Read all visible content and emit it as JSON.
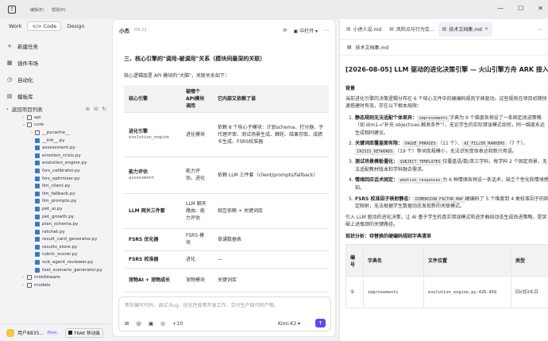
{
  "titlebar": {
    "logo": "T",
    "menu": [
      "编辑(E)",
      "帮助(H)"
    ],
    "controls": {
      "minimize": "—",
      "maximize": "☐",
      "close": "✕"
    }
  },
  "sidebar": {
    "modes": [
      {
        "label": "Work",
        "active": false
      },
      {
        "label": "Code",
        "active": true,
        "icon": "code-icon"
      },
      {
        "label": "Design",
        "active": false
      }
    ],
    "nav": [
      {
        "label": "新建任务",
        "icon": "plus-icon",
        "glyph": "+"
      },
      {
        "label": "插件市场",
        "icon": "grid-icon",
        "glyph": "▦"
      },
      {
        "label": "自动化",
        "icon": "clock-icon",
        "glyph": "◷"
      },
      {
        "label": "模板库",
        "icon": "template-icon",
        "glyph": "▤"
      }
    ],
    "project_header": "返回项目列表",
    "tree": [
      {
        "label": "api",
        "type": "folder",
        "depth": 2,
        "open": false
      },
      {
        "label": "core",
        "type": "folder",
        "depth": 2,
        "open": true
      },
      {
        "label": "__pycache__",
        "type": "folder",
        "depth": 3,
        "open": false
      },
      {
        "label": "__init__.py",
        "type": "py",
        "depth": 3
      },
      {
        "label": "assessment.py",
        "type": "py",
        "depth": 3
      },
      {
        "label": "emotion_crisis.py",
        "type": "py",
        "depth": 3
      },
      {
        "label": "evolution_engine.py",
        "type": "py",
        "depth": 3
      },
      {
        "label": "fsrs_calibrator.py",
        "type": "py",
        "depth": 3
      },
      {
        "label": "fsrs_optimizer.py",
        "type": "py",
        "depth": 3
      },
      {
        "label": "llm_client.py",
        "type": "py",
        "depth": 3
      },
      {
        "label": "llm_fallback.py",
        "type": "py",
        "depth": 3
      },
      {
        "label": "llm_prompts.py",
        "type": "py",
        "depth": 3
      },
      {
        "label": "pet_ai.py",
        "type": "py",
        "depth": 3
      },
      {
        "label": "pet_growth.py",
        "type": "py",
        "depth": 3
      },
      {
        "label": "plan_schema.py",
        "type": "py",
        "depth": 3
      },
      {
        "label": "ratchet.py",
        "type": "py",
        "depth": 3
      },
      {
        "label": "result_card_generator.py",
        "type": "py",
        "depth": 3
      },
      {
        "label": "results_store.py",
        "type": "py",
        "depth": 3
      },
      {
        "label": "rubric_scorer.py",
        "type": "py",
        "depth": 3
      },
      {
        "label": "sub_agent_reviewer.py",
        "type": "py",
        "depth": 3
      },
      {
        "label": "test_scenario_generator.py",
        "type": "py",
        "depth": 3
      },
      {
        "label": "middleware",
        "type": "folder",
        "depth": 2,
        "open": false
      },
      {
        "label": "models",
        "type": "folder",
        "depth": 2,
        "open": false
      }
    ],
    "user": {
      "name": "用户8835...",
      "badge": "Pro+",
      "trae_label": "TRAE 移动端"
    }
  },
  "chat": {
    "title": "小杰",
    "time": "09:21",
    "open_in": "中打开",
    "section_title": "三、核心引擎的\"调用-被调用\"关系（模块间最深的关联）",
    "intro": "核心逻辑层是 API 模块的\"大脑\"，关联关系如下：",
    "table_headers": [
      "核心引擎",
      "被哪个 API模块 调用",
      "它内部又依赖了谁"
    ],
    "rows": [
      {
        "name": "进化引擎",
        "code": "evolution_engine",
        "caller": "进化模块",
        "deps": "依赖 8 个核心子模块：计划schema、打分器、子代理评审、测试场景生成、棘轮、结果存取、成绩卡生成、FSRS校准器"
      },
      {
        "name": "能力评估",
        "code": "assessment",
        "caller": "能力评估、进化",
        "deps": "依赖 LLM 三件套（client/prompts/fallback）"
      },
      {
        "name": "LLM 网关三件套",
        "code": "",
        "caller": "LLM 聊天路由、能力评估",
        "deps": "相互依赖 + 关键词库"
      },
      {
        "name": "FSRS 优化器",
        "code": "",
        "caller": "FSRS 模块",
        "deps": "背诵数据表"
      },
      {
        "name": "FSRS 校准器",
        "code": "",
        "caller": "进化",
        "deps": "—"
      },
      {
        "name": "宠物AI + 宠物成长",
        "code": "",
        "caller": "宠物模块",
        "deps": "关键词库"
      }
    ],
    "composer": {
      "placeholder": "帮你编写代码、调试 Bug、优化性能等开发工作，交付生产级代码产物。",
      "plus_count": "+10",
      "model": "Kimi-K3",
      "send": "↑"
    }
  },
  "doc": {
    "tabs": [
      {
        "label": "小虎人设.md",
        "active": false
      },
      {
        "label": "风险点与行为交...",
        "active": false
      },
      {
        "label": "技术文档集.md",
        "active": true
      }
    ],
    "subheader": "技术文档集.md",
    "title": "[2026-08-05] LLM 驱动的进化决策引擎 — 火山引擎方舟 ARK 接入方案",
    "background_heading": "背景",
    "background_text": "当前进化引擎的决策逻辑分布在 6 个核心文件中的硬编码规则字典驱动。这些规则在项目初期快速搭建时有效，存在以下根本局限：",
    "issues": [
      {
        "n": "1.",
        "bold": "静态规则无法适配个体差异：",
        "code": "improvements",
        "text": "字典为 9 个维度各预设了一条固定改进策略（如 dim1→\"补充 objectives 触发条件\"），无论学生的实际错误模式如何，同一维度永远生成相同建议。"
      },
      {
        "n": "2.",
        "bold": "关键词库覆盖面有限：",
        "code": "VAGUE_PHRASES",
        "code_note": "（11 个）、",
        "code2": "AI_FILLER_MARKERS",
        "code2_note": "（7 个）、",
        "code3": "CRISIS_KEYWORDS",
        "text": "（19 个）等词库规模小，无法识别变体表达和新兴用语。"
      },
      {
        "n": "3.",
        "bold": "测试场景模板僵化：",
        "code": "SUBJECT_TEMPLATES",
        "text": "仅覆盖语/数/英三学科，每学科 2 个固定场景，无法适配教材版本和学科融合需求。"
      },
      {
        "n": "4.",
        "bold": "情绪回应话术固定：",
        "code": "emotion_responses",
        "text": "为 6 种情绪各预设一条话术，缺乏个性化和情境感知。"
      },
      {
        "n": "5.",
        "bold": "FSRS 校准因子映射静态：",
        "code": "DIMENSION_FACTOR_MAP",
        "text": "硬编码了 5 个维度到 4 类校准因子的固定映射，无法根据学生数据动态发现新的关联模式。"
      }
    ],
    "conclusion": "引入 LLM 驱动的进化决策，让 AI 基于学生的真实错误模式和进步曲线动态生成改进策略，是突破上述瓶颈的关键路径。",
    "survey_heading": "现状分析：待替换的硬编码规则字典清单",
    "reg_headers": [
      "编号",
      "字典名",
      "文件位置",
      "类型"
    ],
    "reg_rows": [
      {
        "num": "①",
        "name": "improvements",
        "loc": "evolution_engine.py:426-459",
        "type": "Dict[int,D"
      }
    ]
  }
}
